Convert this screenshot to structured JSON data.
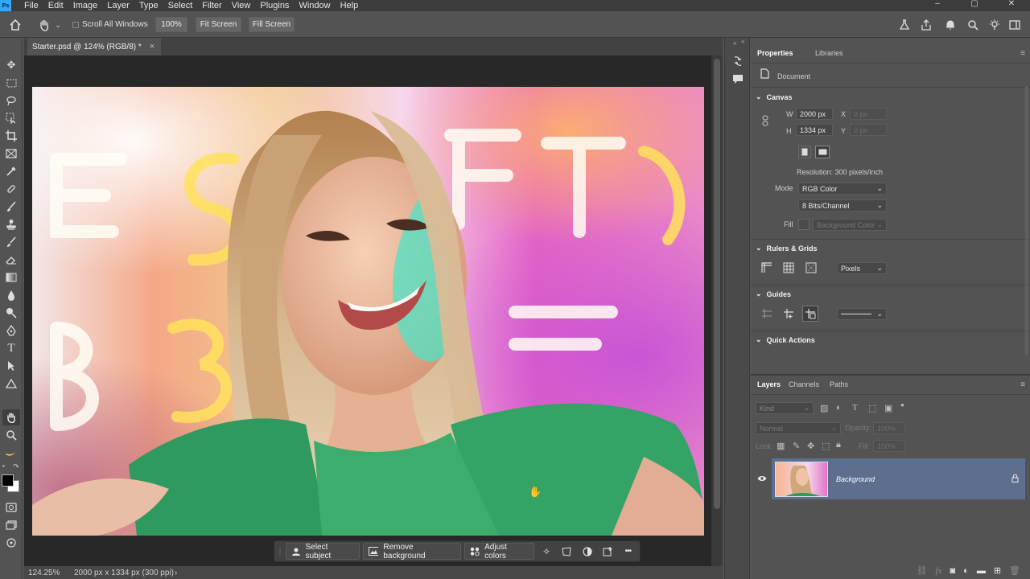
{
  "menubar": {
    "logo": "Ps",
    "items": [
      "File",
      "Edit",
      "Image",
      "Layer",
      "Type",
      "Select",
      "Filter",
      "View",
      "Plugins",
      "Window",
      "Help"
    ],
    "window_controls": [
      "–",
      "▢",
      "✕"
    ]
  },
  "options": {
    "scroll_all_windows": "Scroll All Windows",
    "zoom_100": "100%",
    "fit_screen": "Fit Screen",
    "fill_screen": "Fill Screen"
  },
  "document": {
    "tab_title": "Starter.psd @ 124% (RGB/8) *",
    "close": "×"
  },
  "contextbar": {
    "select_subject": "Select subject",
    "remove_background": "Remove background",
    "adjust_colors": "Adjust colors",
    "more": "•••"
  },
  "status": {
    "zoom": "124.25%",
    "doc_info": "2000 px x 1334 px (300 ppi)",
    "arrow": "›"
  },
  "properties": {
    "tabs": [
      "Properties",
      "Libraries"
    ],
    "document_label": "Document",
    "canvas": {
      "title": "Canvas",
      "w_label": "W",
      "w_value": "2000 px",
      "h_label": "H",
      "h_value": "1334 px",
      "x_label": "X",
      "x_value": "0 px",
      "y_label": "Y",
      "y_value": "0 px",
      "resolution": "Resolution: 300 pixels/inch",
      "mode_label": "Mode",
      "mode_value": "RGB Color",
      "bits_value": "8 Bits/Channel",
      "fill_label": "Fill",
      "fill_value": "Background Color"
    },
    "rulers": {
      "title": "Rulers & Grids",
      "units": "Pixels"
    },
    "guides": {
      "title": "Guides"
    },
    "quick_actions": {
      "title": "Quick Actions"
    }
  },
  "layers": {
    "tabs": [
      "Layers",
      "Channels",
      "Paths"
    ],
    "kind_label": "Kind",
    "blend_mode": "Normal",
    "opacity_label": "Opacity:",
    "opacity_value": "100%",
    "lock_label": "Lock:",
    "fill_label": "Fill:",
    "fill_value": "100%",
    "layer_name": "Background"
  },
  "colors": {
    "accent": "#31a8ff",
    "selected_layer": "#5d6e8f",
    "canvas_bg": "#282828",
    "panel": "#535353"
  }
}
